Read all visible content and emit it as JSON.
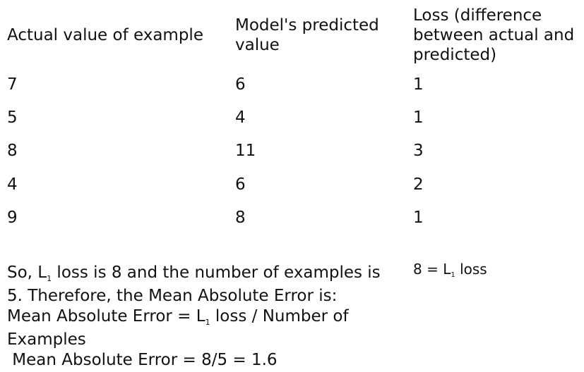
{
  "table": {
    "headers": [
      "Actual value of example",
      "Model's predicted value",
      "Loss (difference between actual and predicted)"
    ],
    "rows": [
      [
        "7",
        "6",
        "1"
      ],
      [
        "5",
        "4",
        "1"
      ],
      [
        "8",
        "11",
        "3"
      ],
      [
        "4",
        "6",
        "2"
      ],
      [
        "9",
        "8",
        "1"
      ]
    ]
  },
  "explanation": {
    "l": "L",
    "sub": "1",
    "line1_before": "So, ",
    "line1_after": " loss is 8 and the number of examples is",
    "line2": "5. Therefore, the Mean Absolute Error is:",
    "line3_before": "Mean Absolute Error = ",
    "line3_after": " loss / Number of",
    "line4": "Examples",
    "line5": " Mean Absolute Error = 8/5 = 1.6"
  },
  "side_note": {
    "before": "8 = ",
    "l": "L",
    "sub": "1",
    "after": " loss"
  }
}
